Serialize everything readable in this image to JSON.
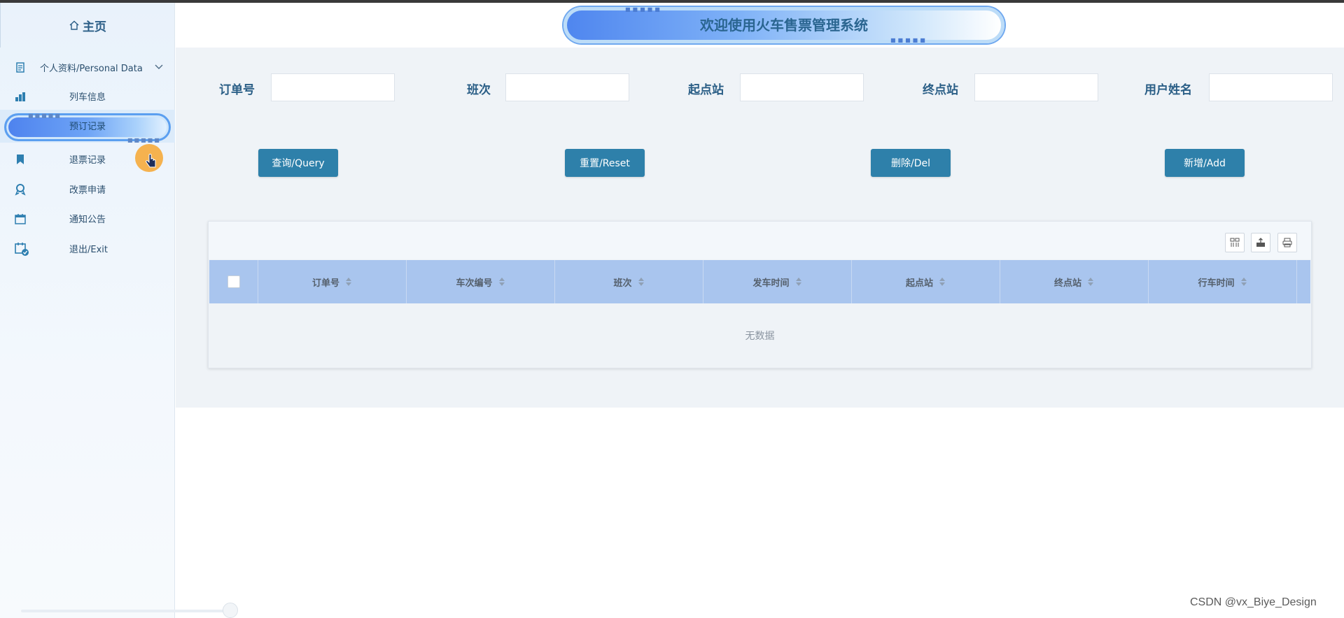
{
  "sidebar": {
    "home_label": "主页",
    "items": [
      {
        "label": "个人资料/Personal Data",
        "icon": "document-icon"
      },
      {
        "label": "列车信息",
        "icon": "bar-chart-icon"
      },
      {
        "label": "预订记录",
        "icon": "ticket-icon"
      },
      {
        "label": "退票记录",
        "icon": "bookmark-icon"
      },
      {
        "label": "改票申请",
        "icon": "award-icon"
      },
      {
        "label": "通知公告",
        "icon": "calendar-icon"
      },
      {
        "label": "退出/Exit",
        "icon": "calendar-check-icon"
      }
    ]
  },
  "header": {
    "title": "欢迎使用火车售票管理系统"
  },
  "search": {
    "fields": [
      {
        "label": "订单号",
        "value": ""
      },
      {
        "label": "班次",
        "value": ""
      },
      {
        "label": "起点站",
        "value": ""
      },
      {
        "label": "终点站",
        "value": ""
      },
      {
        "label": "用户姓名",
        "value": ""
      }
    ]
  },
  "buttons": {
    "query": "查询/Query",
    "reset": "重置/Reset",
    "delete": "删除/Del",
    "add": "新增/Add"
  },
  "table": {
    "columns": [
      "订单号",
      "车次编号",
      "班次",
      "发车时间",
      "起点站",
      "终点站",
      "行车时间"
    ],
    "empty_text": "无数据"
  },
  "watermark": "CSDN @vx_Biye_Design",
  "colors": {
    "accent": "#2e80aa",
    "title": "#2a5e86",
    "table_header": "#a9c5ee",
    "main_bg": "#eff3f7"
  }
}
